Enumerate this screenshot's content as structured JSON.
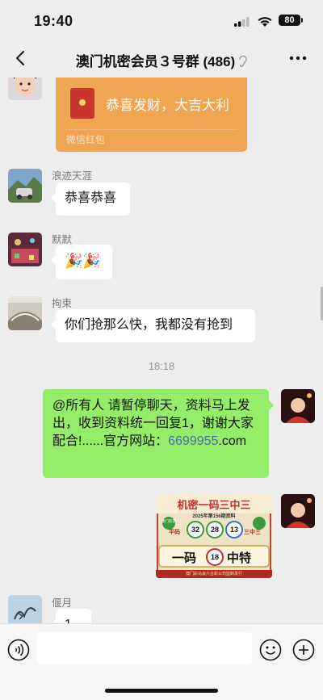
{
  "status": {
    "time": "19:40",
    "battery": "80"
  },
  "header": {
    "title": "澳门机密会员３号群 (486)"
  },
  "messages": {
    "red_packet": {
      "text": "恭喜发财，大吉大利",
      "label": "微信红包"
    },
    "m1": {
      "sender": "浪迹天涯",
      "text": "恭喜恭喜"
    },
    "m2": {
      "sender": "默默",
      "text": "🎉🎉"
    },
    "m3": {
      "sender": "拘束",
      "text": "你们抢那么快，我都没有抢到"
    },
    "timestamp": "18:18",
    "m4": {
      "text": "@所有人 请暂停聊天，资料马上发出，收到资料统一回复1，谢谢大家配合!......官方网站：",
      "link": "6699955",
      "suffix": ".com"
    },
    "poster": {
      "title": "机密一码三中三",
      "subtitle": "2025年第156期资料",
      "left_label": "平码",
      "right_label": "三中三",
      "numbers": [
        "32",
        "28",
        "13"
      ],
      "special_left": "一码",
      "special_number": "18",
      "special_right": "中特",
      "footer": "澳门彩马会六合彩公司监制发行",
      "logo": "澳门彩票"
    },
    "m5": {
      "sender": "偃月",
      "text": "1"
    }
  },
  "colors": {
    "green_bubble": "#95ec69",
    "red_packet": "#f0a552",
    "link": "#4a6fa5"
  },
  "icons": [
    "back-icon",
    "ear-icon",
    "more-icon",
    "voice-icon",
    "emoji-icon",
    "plus-icon"
  ]
}
